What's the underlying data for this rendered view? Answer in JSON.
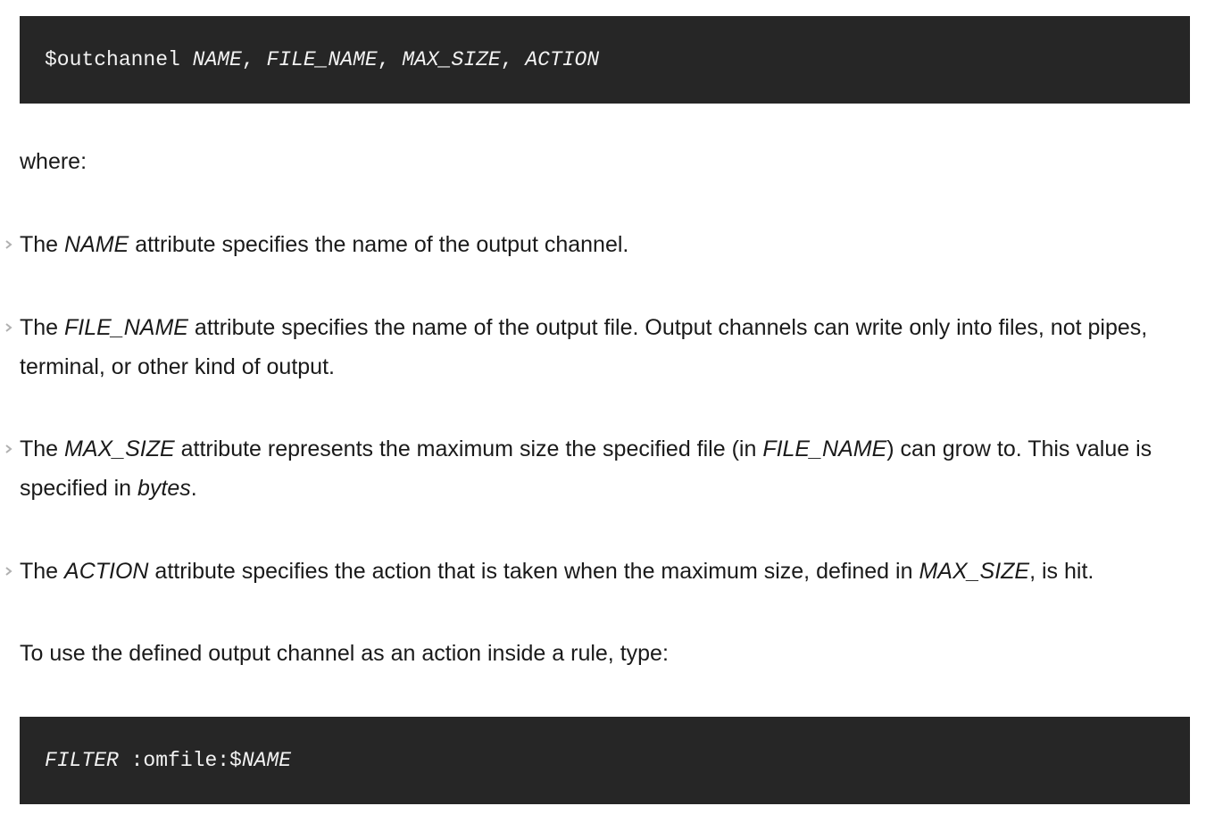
{
  "code1": {
    "command": "$outchannel ",
    "args": [
      {
        "text": "NAME",
        "italic": true
      },
      {
        "text": ", ",
        "italic": false
      },
      {
        "text": "FILE_NAME",
        "italic": true
      },
      {
        "text": ", ",
        "italic": false
      },
      {
        "text": "MAX_SIZE",
        "italic": true
      },
      {
        "text": ", ",
        "italic": false
      },
      {
        "text": "ACTION",
        "italic": true
      }
    ]
  },
  "where_label": "where:",
  "items": [
    {
      "parts": [
        {
          "text": "The ",
          "italic": false
        },
        {
          "text": "NAME",
          "italic": true
        },
        {
          "text": " attribute specifies the name of the output channel.",
          "italic": false
        }
      ]
    },
    {
      "parts": [
        {
          "text": "The ",
          "italic": false
        },
        {
          "text": "FILE_NAME",
          "italic": true
        },
        {
          "text": " attribute specifies the name of the output file. Output channels can write only into files, not pipes, terminal, or other kind of output.",
          "italic": false
        }
      ]
    },
    {
      "parts": [
        {
          "text": "The ",
          "italic": false
        },
        {
          "text": "MAX_SIZE",
          "italic": true
        },
        {
          "text": " attribute represents the maximum size the specified file (in ",
          "italic": false
        },
        {
          "text": "FILE_NAME",
          "italic": true
        },
        {
          "text": ") can grow to. This value is specified in ",
          "italic": false
        },
        {
          "text": "bytes",
          "italic": true
        },
        {
          "text": ".",
          "italic": false
        }
      ]
    },
    {
      "parts": [
        {
          "text": "The ",
          "italic": false
        },
        {
          "text": "ACTION",
          "italic": true
        },
        {
          "text": " attribute specifies the action that is taken when the maximum size, defined in ",
          "italic": false
        },
        {
          "text": "MAX_SIZE",
          "italic": true
        },
        {
          "text": ", is hit.",
          "italic": false
        }
      ]
    }
  ],
  "usage_text": "To use the defined output channel as an action inside a rule, type:",
  "code2": {
    "parts": [
      {
        "text": "FILTER",
        "italic": true
      },
      {
        "text": " :omfile:$",
        "italic": false
      },
      {
        "text": "NAME",
        "italic": true
      }
    ]
  },
  "colors": {
    "code_background": "#262626",
    "code_text": "#f2f2f2",
    "body_text": "#1a1a1a",
    "bullet": "#b0b0b0"
  },
  "icons": {
    "bullet": "chevron-right-icon"
  }
}
